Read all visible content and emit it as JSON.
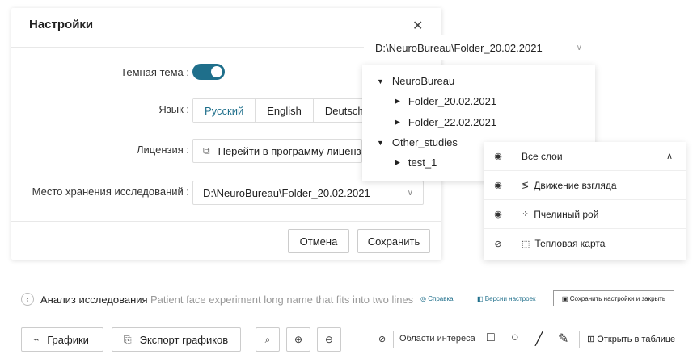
{
  "dialog": {
    "title": "Настройки",
    "close_icon": "✕",
    "dark_theme_label": "Темная тема :",
    "language_label": "Язык :",
    "languages": [
      "Русский",
      "English",
      "Deutsch"
    ],
    "active_language": "Русский",
    "license_label": "Лицензия :",
    "license_button": "Перейти в программу лицензий",
    "storage_label": "Место хранения исследований :",
    "storage_value": "D:\\NeuroBureau\\Folder_20.02.2021",
    "cancel_label": "Отмена",
    "save_label": "Сохранить"
  },
  "folder_picker": {
    "selected": "D:\\NeuroBureau\\Folder_20.02.2021",
    "tree": [
      {
        "label": "NeuroBureau",
        "level": 0,
        "expanded": true
      },
      {
        "label": "Folder_20.02.2021",
        "level": 1,
        "expanded": false
      },
      {
        "label": "Folder_22.02.2021",
        "level": 1,
        "expanded": false
      },
      {
        "label": "Other_studies",
        "level": 0,
        "expanded": true
      },
      {
        "label": "test_1",
        "level": 1,
        "expanded": false
      }
    ]
  },
  "layers": {
    "items": [
      {
        "label": "Все слои",
        "icon": "eye-icon"
      },
      {
        "label": "Движение взгляда",
        "icon": "gaze-path-icon"
      },
      {
        "label": "Пчелиный рой",
        "icon": "bee-swarm-icon"
      },
      {
        "label": "Тепловая карта",
        "icon": "heatmap-icon"
      }
    ]
  },
  "breadcrumb": {
    "title": "Анализ исследования",
    "subtitle": "Patient face experiment long name that fits into two lines",
    "help_label": "Справка",
    "versions_label": "Версии настроек",
    "save_close_label": "Сохранить настройки и закрыть"
  },
  "toolbar": {
    "charts_label": "Графики",
    "export_label": "Экспорт графиков",
    "roi_label": "Области интереса",
    "open_table_label": "Открыть в таблице"
  },
  "colors": {
    "accent": "#1f6f8b"
  }
}
